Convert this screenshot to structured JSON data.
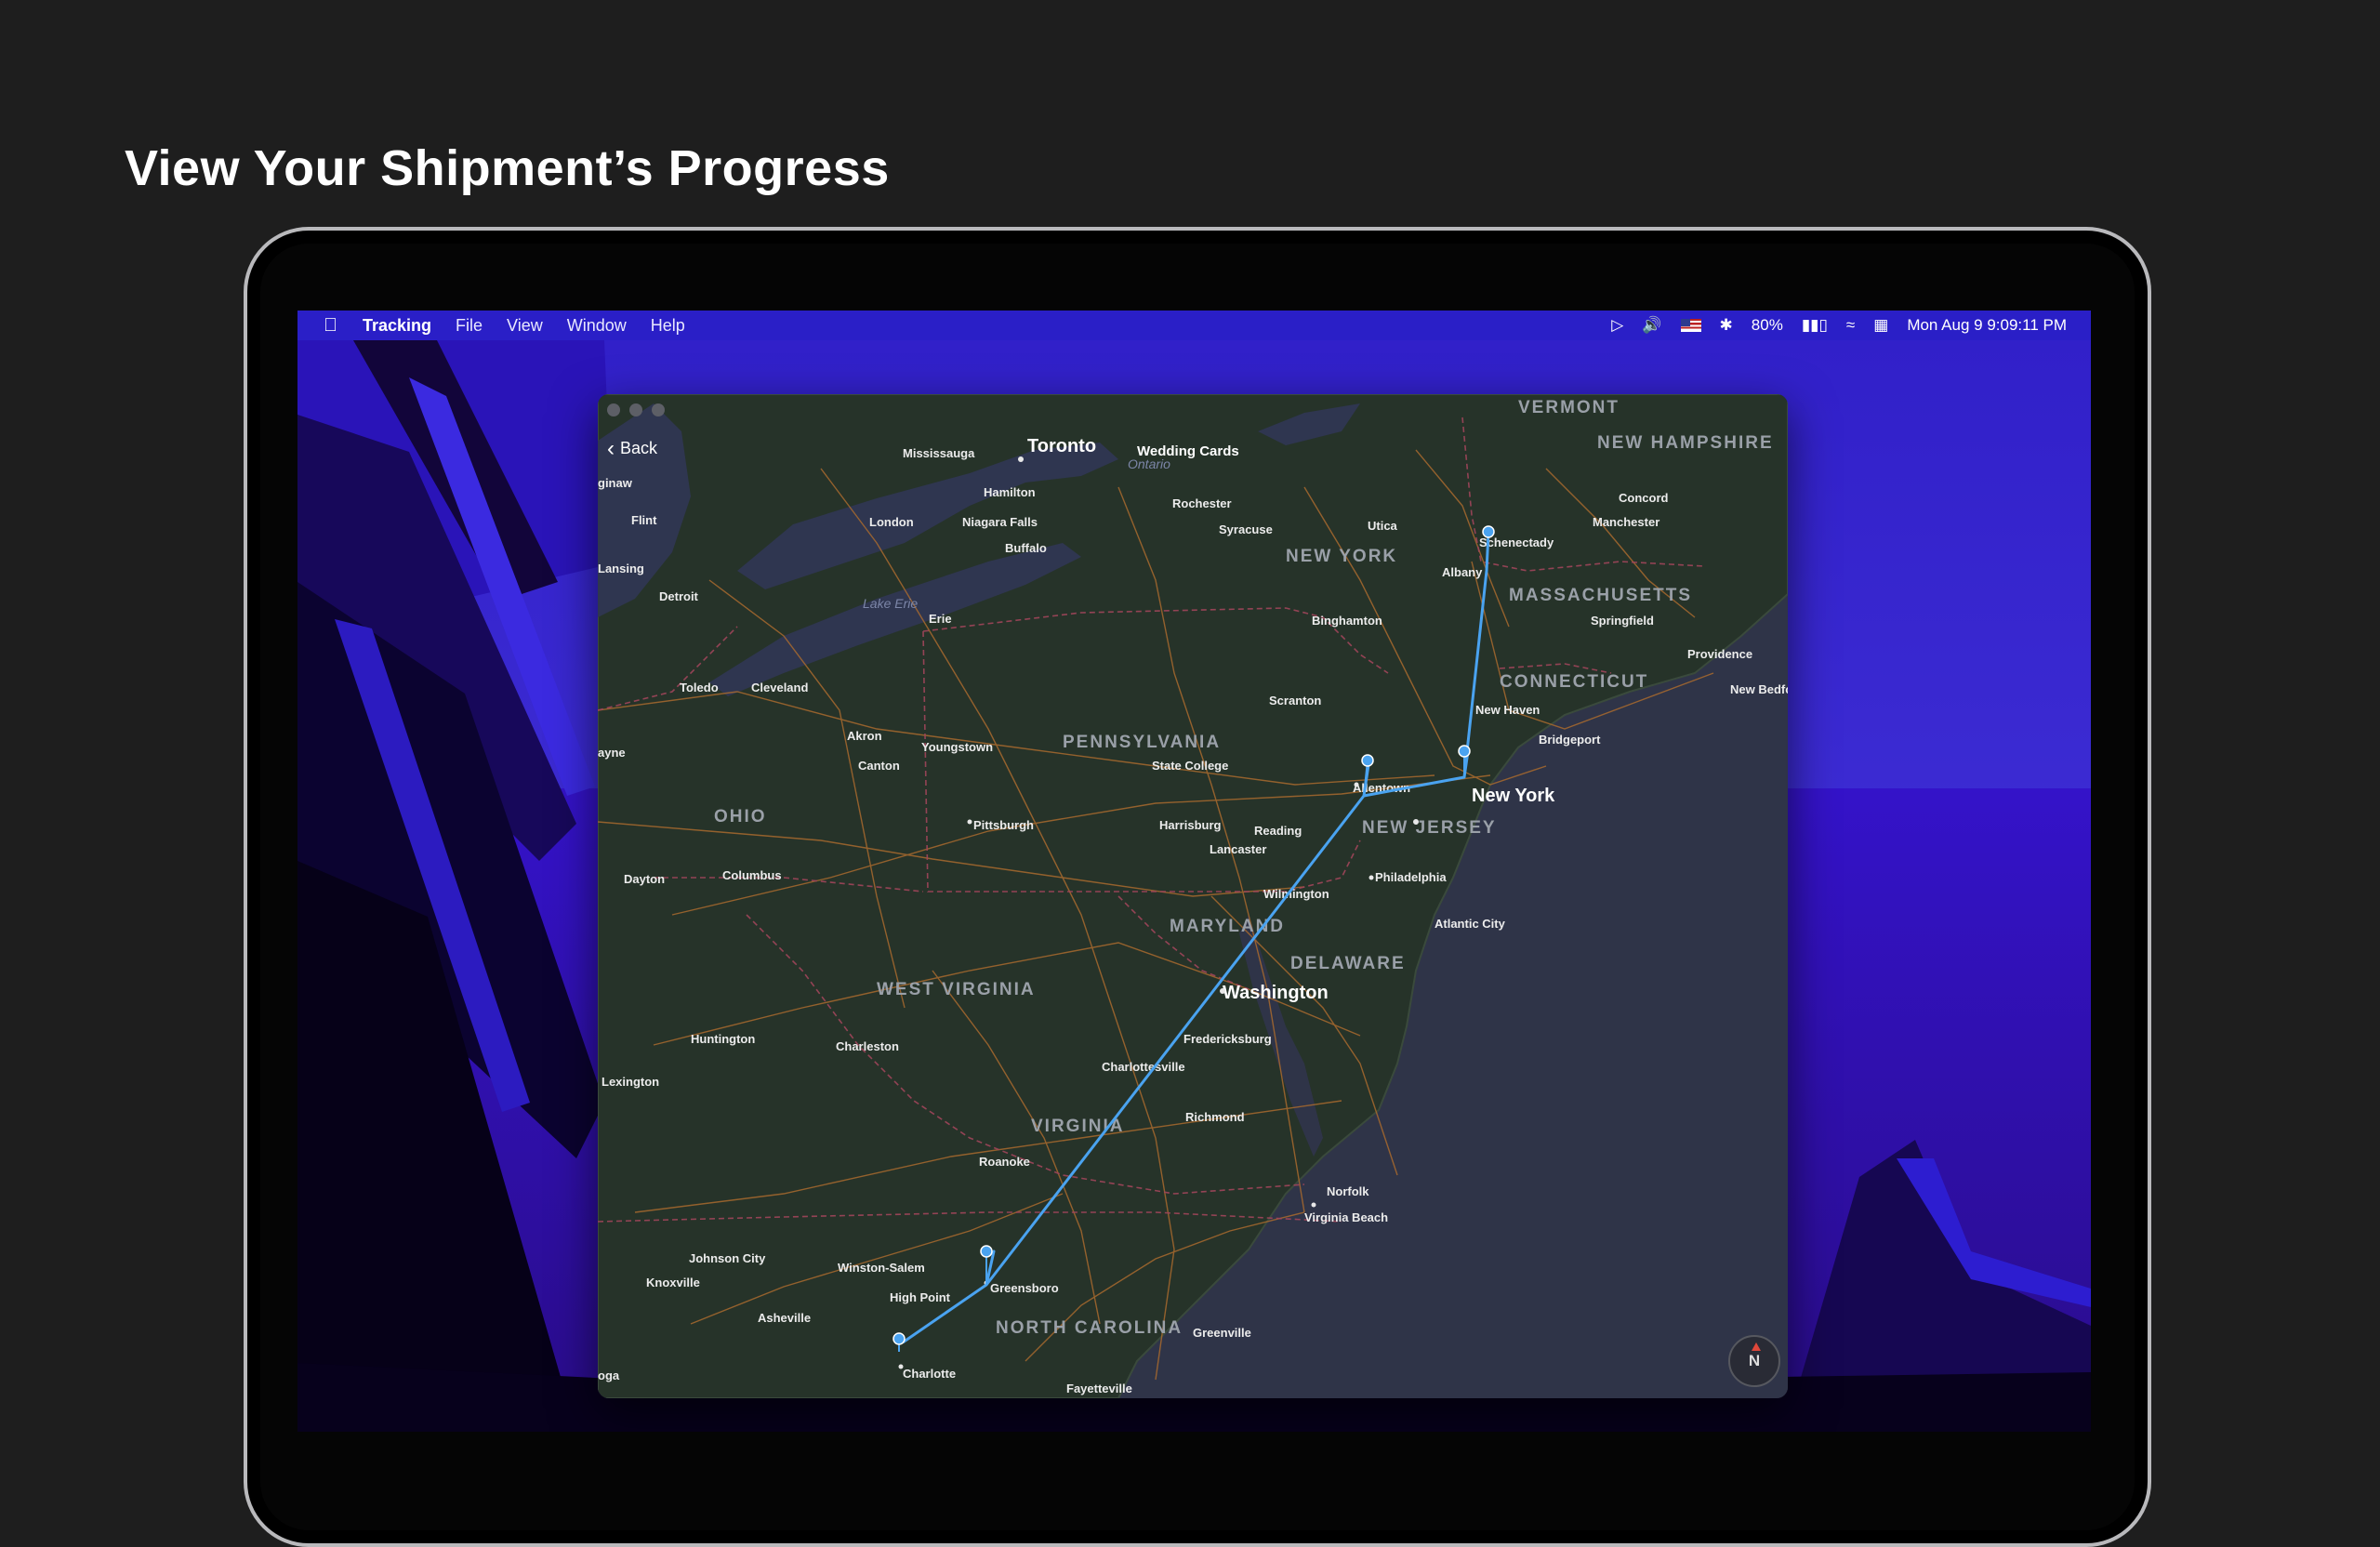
{
  "headline": "View Your Shipment’s Progress",
  "menubar": {
    "app_name": "Tracking",
    "items": [
      "File",
      "View",
      "Window",
      "Help"
    ],
    "battery": "80%",
    "clock": "Mon Aug 9  9:09:11 PM"
  },
  "window": {
    "back_label": "Back",
    "compass_label": "N"
  },
  "map": {
    "states": [
      "VERMONT",
      "NEW HAMPSHIRE",
      "NEW YORK",
      "MASSACHUSETTS",
      "CONNECTICUT",
      "PENNSYLVANIA",
      "NEW JERSEY",
      "OHIO",
      "MARYLAND",
      "DELAWARE",
      "WEST VIRGINIA",
      "VIRGINIA",
      "NORTH CAROLINA"
    ],
    "lakes": [
      "Ontario",
      "Lake Erie"
    ],
    "cities_major": [
      "Toronto",
      "New York",
      "Washington"
    ],
    "cities": [
      "Wedding Cards",
      "Mississauga",
      "Hamilton",
      "London",
      "Niagara Falls",
      "Buffalo",
      "Rochester",
      "Syracuse",
      "Utica",
      "Schenectady",
      "Albany",
      "Concord",
      "Manchester",
      "Springfield",
      "Providence",
      "New Bedford",
      "Flint",
      "Lansing",
      "Detroit",
      "Toledo",
      "Cleveland",
      "Erie",
      "Binghamton",
      "Scranton",
      "New Haven",
      "Bridgeport",
      "Akron",
      "Youngstown",
      "Canton",
      "State College",
      "Allentown",
      "Pittsburgh",
      "Harrisburg",
      "Reading",
      "Lancaster",
      "Philadelphia",
      "Wilmington",
      "Atlantic City",
      "Dayton",
      "Columbus",
      "Huntington",
      "Charleston",
      "Lexington",
      "Fredericksburg",
      "Charlottesville",
      "Richmond",
      "Roanoke",
      "Norfolk",
      "Virginia Beach",
      "Johnson City",
      "Knoxville",
      "Winston-Salem",
      "High Point",
      "Greensboro",
      "Asheville",
      "Greenville",
      "Charlotte",
      "Fayetteville"
    ],
    "edge_labels": [
      "ginaw",
      "ayne",
      "oga"
    ],
    "route_stops": [
      "Charlotte",
      "Greensboro",
      "Allentown",
      "New York",
      "Schenectady"
    ]
  }
}
